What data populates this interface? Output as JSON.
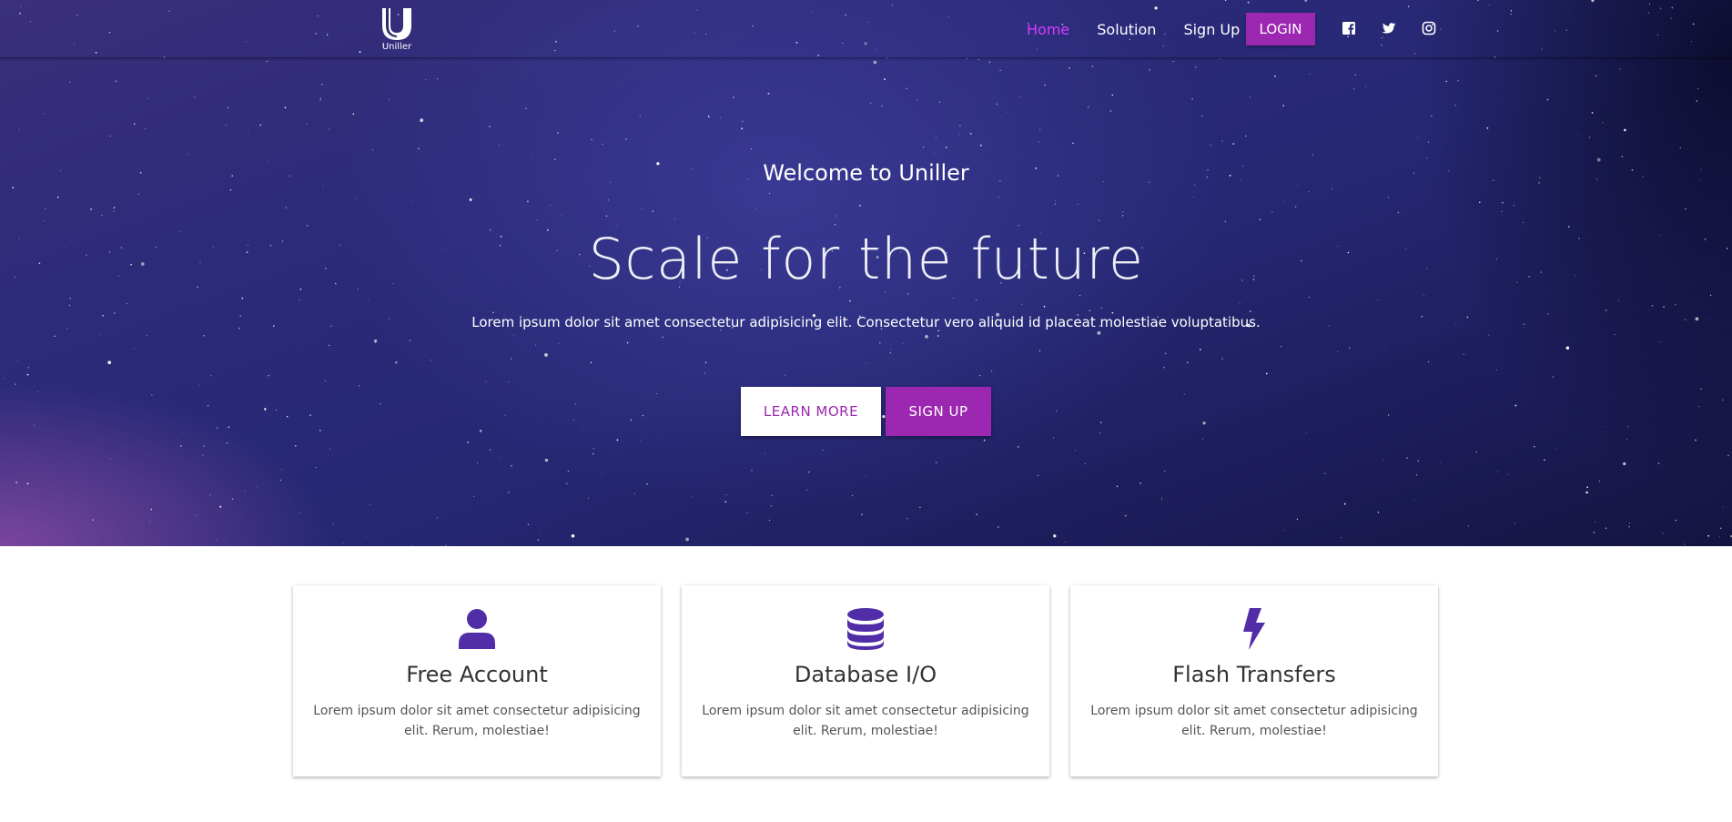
{
  "colors": {
    "accent": "#9c27b0",
    "nav_active": "#d63cff",
    "icon": "#512da8",
    "text_dark": "#333333",
    "text_muted": "#555555"
  },
  "brand": {
    "logo_icon": "u-logo-icon",
    "name": "Uniller"
  },
  "nav": {
    "items": [
      {
        "label": "Home",
        "active": true
      },
      {
        "label": "Solution",
        "active": false
      },
      {
        "label": "Sign Up",
        "active": false
      }
    ],
    "login_label": "LOGIN",
    "social": [
      "facebook-icon",
      "twitter-icon",
      "instagram-icon"
    ]
  },
  "hero": {
    "welcome": "Welcome to Uniller",
    "headline": "Scale for the future",
    "lead": "Lorem ipsum dolor sit amet consectetur adipisicing elit. Consectetur vero aliquid id placeat molestiae voluptatibus.",
    "learn_more_label": "LEARN MORE",
    "sign_up_label": "SIGN UP"
  },
  "features": [
    {
      "icon": "user-icon",
      "title": "Free Account",
      "text": "Lorem ipsum dolor sit amet consectetur adipisicing elit. Rerum, molestiae!"
    },
    {
      "icon": "database-icon",
      "title": "Database I/O",
      "text": "Lorem ipsum dolor sit amet consectetur adipisicing elit. Rerum, molestiae!"
    },
    {
      "icon": "bolt-icon",
      "title": "Flash Transfers",
      "text": "Lorem ipsum dolor sit amet consectetur adipisicing elit. Rerum, molestiae!"
    }
  ]
}
